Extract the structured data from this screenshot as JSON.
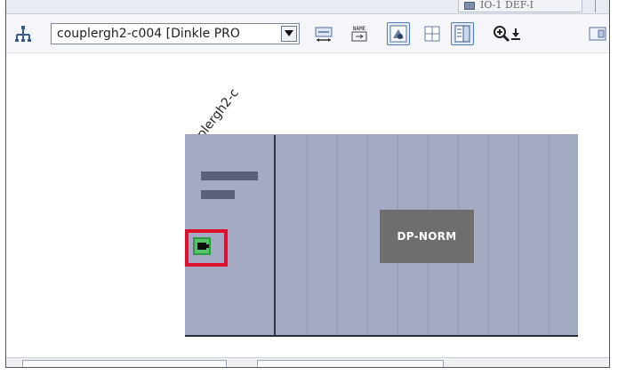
{
  "top_tab": {
    "label": "IO-1 DEF-I"
  },
  "toolbar": {
    "device_select": {
      "value": "couplergh2-c004 [Dinkle PRO"
    },
    "name_icon_text": "NAME"
  },
  "canvas": {
    "device_label": "couplergh2-c",
    "module": {
      "name_box": "DP-NORM"
    }
  },
  "colors": {
    "module_fill": "#a4a9c4",
    "port_green": "#56c26a",
    "highlight_red": "#e0102c",
    "name_box_fill": "#6e6e6e"
  },
  "icons": {
    "network_view": "network-topology-icon",
    "select_arrow": "chevron-down-icon",
    "fit": "fit-width-icon",
    "show_names": "show-names-icon",
    "overview": "page-overview-icon",
    "grid": "grid-icon",
    "panel": "panel-icon",
    "zoom": "zoom-in-icon",
    "download": "download-icon",
    "device_port": "ethernet-port-icon"
  }
}
